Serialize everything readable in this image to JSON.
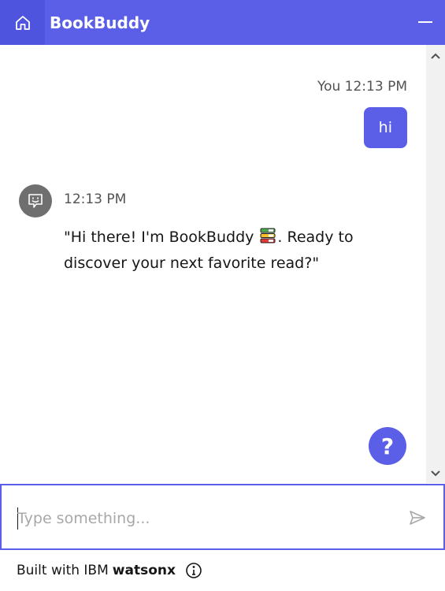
{
  "header": {
    "title": "BookBuddy",
    "home_icon": "home-icon",
    "minimize_icon": "minimize-icon",
    "accent_color": "#5b5fe8"
  },
  "messages": {
    "user": {
      "sender": "You",
      "time": "12:13 PM",
      "text": "hi"
    },
    "bot": {
      "avatar_icon": "chatbot-avatar-icon",
      "time": "12:13 PM",
      "text_before": "\"Hi there! I'm BookBuddy ",
      "emoji_icon": "books-emoji-icon",
      "text_after": ". Ready to discover your next favorite read?\""
    }
  },
  "help_button": {
    "label": "?"
  },
  "input": {
    "placeholder": "Type something...",
    "value": "",
    "send_icon": "send-icon"
  },
  "footer": {
    "prefix": "Built with IBM",
    "brand": "watsonx",
    "info_icon": "info-icon"
  }
}
